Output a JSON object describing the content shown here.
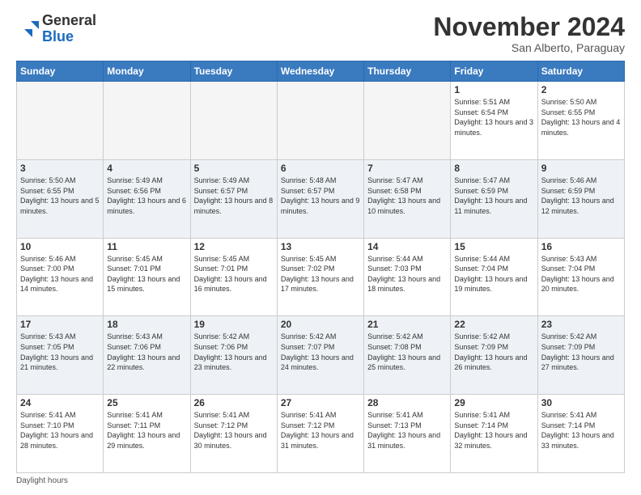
{
  "header": {
    "logo_line1": "General",
    "logo_line2": "Blue",
    "month_title": "November 2024",
    "location": "San Alberto, Paraguay"
  },
  "days_of_week": [
    "Sunday",
    "Monday",
    "Tuesday",
    "Wednesday",
    "Thursday",
    "Friday",
    "Saturday"
  ],
  "footer": {
    "daylight_label": "Daylight hours"
  },
  "weeks": [
    {
      "row_alt": false,
      "days": [
        {
          "num": "",
          "info": ""
        },
        {
          "num": "",
          "info": ""
        },
        {
          "num": "",
          "info": ""
        },
        {
          "num": "",
          "info": ""
        },
        {
          "num": "",
          "info": ""
        },
        {
          "num": "1",
          "info": "Sunrise: 5:51 AM\nSunset: 6:54 PM\nDaylight: 13 hours and 3 minutes."
        },
        {
          "num": "2",
          "info": "Sunrise: 5:50 AM\nSunset: 6:55 PM\nDaylight: 13 hours and 4 minutes."
        }
      ]
    },
    {
      "row_alt": true,
      "days": [
        {
          "num": "3",
          "info": "Sunrise: 5:50 AM\nSunset: 6:55 PM\nDaylight: 13 hours and 5 minutes."
        },
        {
          "num": "4",
          "info": "Sunrise: 5:49 AM\nSunset: 6:56 PM\nDaylight: 13 hours and 6 minutes."
        },
        {
          "num": "5",
          "info": "Sunrise: 5:49 AM\nSunset: 6:57 PM\nDaylight: 13 hours and 8 minutes."
        },
        {
          "num": "6",
          "info": "Sunrise: 5:48 AM\nSunset: 6:57 PM\nDaylight: 13 hours and 9 minutes."
        },
        {
          "num": "7",
          "info": "Sunrise: 5:47 AM\nSunset: 6:58 PM\nDaylight: 13 hours and 10 minutes."
        },
        {
          "num": "8",
          "info": "Sunrise: 5:47 AM\nSunset: 6:59 PM\nDaylight: 13 hours and 11 minutes."
        },
        {
          "num": "9",
          "info": "Sunrise: 5:46 AM\nSunset: 6:59 PM\nDaylight: 13 hours and 12 minutes."
        }
      ]
    },
    {
      "row_alt": false,
      "days": [
        {
          "num": "10",
          "info": "Sunrise: 5:46 AM\nSunset: 7:00 PM\nDaylight: 13 hours and 14 minutes."
        },
        {
          "num": "11",
          "info": "Sunrise: 5:45 AM\nSunset: 7:01 PM\nDaylight: 13 hours and 15 minutes."
        },
        {
          "num": "12",
          "info": "Sunrise: 5:45 AM\nSunset: 7:01 PM\nDaylight: 13 hours and 16 minutes."
        },
        {
          "num": "13",
          "info": "Sunrise: 5:45 AM\nSunset: 7:02 PM\nDaylight: 13 hours and 17 minutes."
        },
        {
          "num": "14",
          "info": "Sunrise: 5:44 AM\nSunset: 7:03 PM\nDaylight: 13 hours and 18 minutes."
        },
        {
          "num": "15",
          "info": "Sunrise: 5:44 AM\nSunset: 7:04 PM\nDaylight: 13 hours and 19 minutes."
        },
        {
          "num": "16",
          "info": "Sunrise: 5:43 AM\nSunset: 7:04 PM\nDaylight: 13 hours and 20 minutes."
        }
      ]
    },
    {
      "row_alt": true,
      "days": [
        {
          "num": "17",
          "info": "Sunrise: 5:43 AM\nSunset: 7:05 PM\nDaylight: 13 hours and 21 minutes."
        },
        {
          "num": "18",
          "info": "Sunrise: 5:43 AM\nSunset: 7:06 PM\nDaylight: 13 hours and 22 minutes."
        },
        {
          "num": "19",
          "info": "Sunrise: 5:42 AM\nSunset: 7:06 PM\nDaylight: 13 hours and 23 minutes."
        },
        {
          "num": "20",
          "info": "Sunrise: 5:42 AM\nSunset: 7:07 PM\nDaylight: 13 hours and 24 minutes."
        },
        {
          "num": "21",
          "info": "Sunrise: 5:42 AM\nSunset: 7:08 PM\nDaylight: 13 hours and 25 minutes."
        },
        {
          "num": "22",
          "info": "Sunrise: 5:42 AM\nSunset: 7:09 PM\nDaylight: 13 hours and 26 minutes."
        },
        {
          "num": "23",
          "info": "Sunrise: 5:42 AM\nSunset: 7:09 PM\nDaylight: 13 hours and 27 minutes."
        }
      ]
    },
    {
      "row_alt": false,
      "days": [
        {
          "num": "24",
          "info": "Sunrise: 5:41 AM\nSunset: 7:10 PM\nDaylight: 13 hours and 28 minutes."
        },
        {
          "num": "25",
          "info": "Sunrise: 5:41 AM\nSunset: 7:11 PM\nDaylight: 13 hours and 29 minutes."
        },
        {
          "num": "26",
          "info": "Sunrise: 5:41 AM\nSunset: 7:12 PM\nDaylight: 13 hours and 30 minutes."
        },
        {
          "num": "27",
          "info": "Sunrise: 5:41 AM\nSunset: 7:12 PM\nDaylight: 13 hours and 31 minutes."
        },
        {
          "num": "28",
          "info": "Sunrise: 5:41 AM\nSunset: 7:13 PM\nDaylight: 13 hours and 31 minutes."
        },
        {
          "num": "29",
          "info": "Sunrise: 5:41 AM\nSunset: 7:14 PM\nDaylight: 13 hours and 32 minutes."
        },
        {
          "num": "30",
          "info": "Sunrise: 5:41 AM\nSunset: 7:14 PM\nDaylight: 13 hours and 33 minutes."
        }
      ]
    }
  ]
}
